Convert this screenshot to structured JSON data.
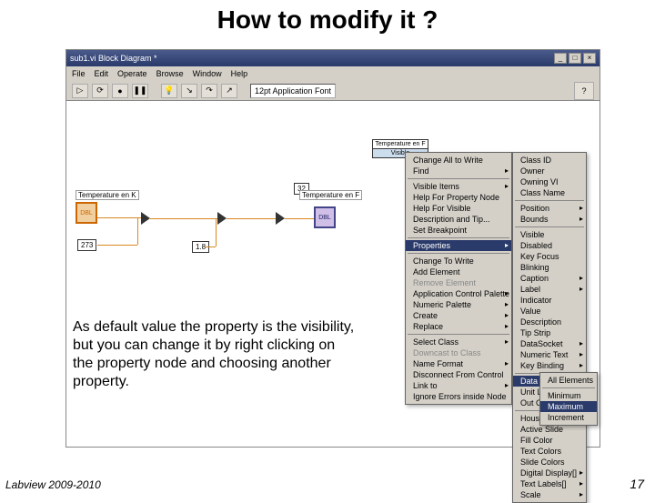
{
  "slide": {
    "title": "How to modify it ?",
    "caption": "As default value the property is the visibility, but you can change it by right clicking on the property node and choosing another property.",
    "footer_left": "Labview 2009-2010",
    "footer_right": "17"
  },
  "window": {
    "title": "sub1.vi Block Diagram *",
    "menus": [
      "File",
      "Edit",
      "Operate",
      "Browse",
      "Window",
      "Help"
    ],
    "font_combo": "12pt Application Font"
  },
  "diagram": {
    "label_k": "Temperature en K",
    "label_f": "Temperature en F",
    "val_273": "273",
    "val_1p8": "1.8",
    "val_32": "32",
    "prop_header": "Temperature en F"
  },
  "context_menu": {
    "top": [
      "Change All to Write",
      "Find",
      "",
      "Visible Items",
      "Help For Property Node",
      "Help For Visible",
      "Description and Tip...",
      "Set Breakpoint",
      "",
      "Properties",
      "",
      "Change To Write",
      "Add Element",
      "Remove Element",
      "Application Control Palette",
      "Numeric Palette",
      "Create",
      "Replace",
      "",
      "Select Class",
      "Downcast to Class",
      "Name Format",
      "Disconnect From Control",
      "Link to",
      "Ignore Errors inside Node"
    ],
    "sub1": [
      "Class ID",
      "Owner",
      "Owning VI",
      "Class Name",
      "",
      "Position",
      "Bounds",
      "",
      "Visible",
      "Disabled",
      "Key Focus",
      "Blinking",
      "Caption",
      "Label",
      "Indicator",
      "Value",
      "Description",
      "Tip Strip",
      "DataSocket",
      "Numeric Text",
      "Key Binding",
      "",
      "Data Range",
      "Unit Label",
      "Out Of Range Action",
      "",
      "Housing Size",
      "Active Slide",
      "Fill Color",
      "Text Colors",
      "Slide Colors",
      "Digital Display[]",
      "Text Labels[]",
      "Scale"
    ],
    "sub2": [
      "All Elements",
      "",
      "Minimum",
      "Maximum",
      "Increment"
    ]
  }
}
